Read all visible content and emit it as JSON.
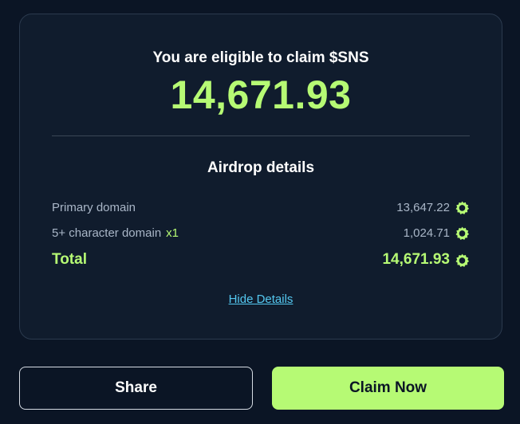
{
  "headline": "You are eligible to claim $SNS",
  "amount": "14,671.93",
  "details": {
    "title": "Airdrop details",
    "rows": [
      {
        "label": "Primary domain",
        "multiplier": "",
        "value": "13,647.22"
      },
      {
        "label": "5+ character domain",
        "multiplier": "x1",
        "value": "1,024.71"
      }
    ],
    "total": {
      "label": "Total",
      "value": "14,671.93"
    },
    "toggle_label": "Hide Details"
  },
  "actions": {
    "share_label": "Share",
    "claim_label": "Claim Now"
  },
  "colors": {
    "background": "#0b1525",
    "card": "#101c2d",
    "accent": "#b6fa74",
    "link": "#54c8f0",
    "muted_text": "#a9b6c7"
  },
  "icons": {
    "token": "sns-token-icon"
  }
}
